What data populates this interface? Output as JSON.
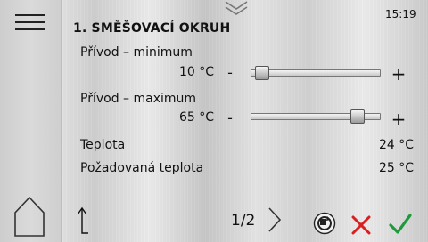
{
  "header": {
    "time": "15:19",
    "title": "1. SMĚŠOVACÍ OKRUH"
  },
  "settings": {
    "supply_min": {
      "label": "Přívod – minimum",
      "value": "10 °C",
      "minus": "-",
      "plus": "+",
      "level": 0.04
    },
    "supply_max": {
      "label": "Přívod – maximum",
      "value": "65 °C",
      "minus": "-",
      "plus": "+",
      "level": 0.86
    },
    "temperature": {
      "label": "Teplota",
      "value": "24 °C"
    },
    "required_temperature": {
      "label": "Požadovaná teplota",
      "value": "25 °C"
    }
  },
  "footer": {
    "page": "1/2"
  },
  "icons": {
    "menu": "hamburger-icon",
    "home": "home-icon",
    "up": "arrow-up-icon",
    "next": "chevron-right-icon",
    "reset": "reset-icon",
    "cancel": "close-icon",
    "confirm": "check-icon",
    "collapse": "double-chevron-down-icon"
  },
  "colors": {
    "cancel": "#d92020",
    "confirm": "#1e9a3c"
  }
}
